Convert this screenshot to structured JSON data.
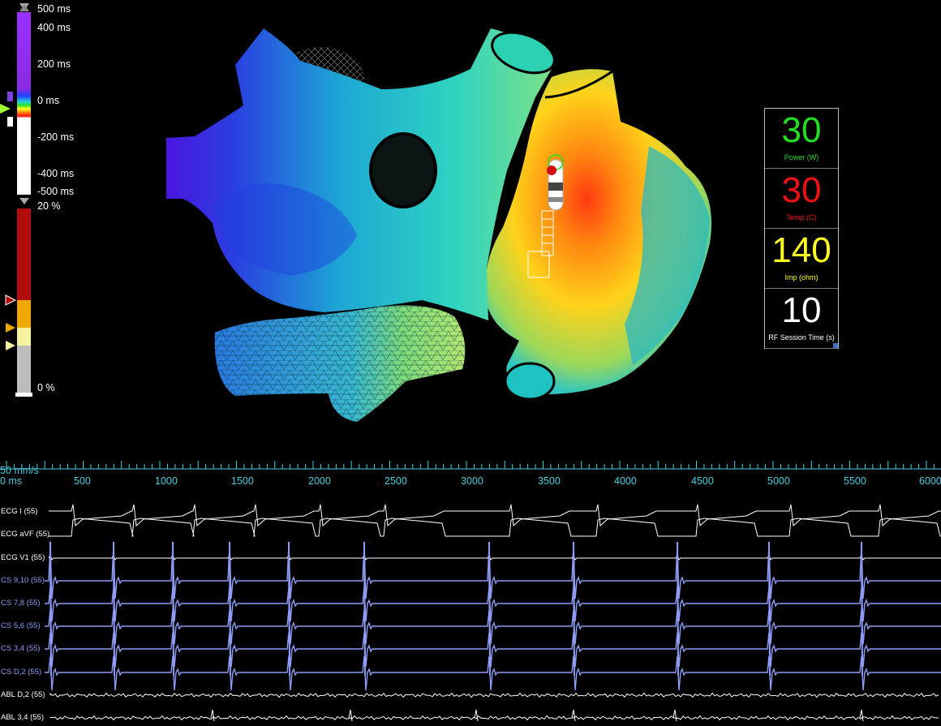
{
  "latency_scale": {
    "labels": [
      "500 ms",
      "400 ms",
      "200 ms",
      "0 ms",
      "-200 ms",
      "-400 ms",
      "-500 ms"
    ],
    "colors": {
      "late": "#8a2be2",
      "early": "#ffffff"
    }
  },
  "percent_scale": {
    "top_label": "20 %",
    "bottom_label": "0 %",
    "colors": {
      "dark_red": "#b00c0c",
      "orange": "#f0a800",
      "yellow": "#f6f3a0",
      "gray": "#bdbdbd"
    }
  },
  "rf_panel": {
    "power": {
      "value": "30",
      "label": "Power (W)",
      "color": "#22dd22"
    },
    "temp": {
      "value": "30",
      "label": "Temp (C)",
      "color": "#ee1111"
    },
    "imp": {
      "value": "140",
      "label": "Imp (ohm)",
      "color": "#ffff22"
    },
    "session": {
      "value": "10",
      "label": "RF Session Time (s)",
      "color": "#ffffff"
    }
  },
  "timeline": {
    "speed": "50 mm/s",
    "start_label": "0 ms",
    "ticks": [
      "500",
      "1000",
      "1500",
      "2000",
      "2500",
      "3000",
      "3500",
      "4000",
      "4500",
      "5000",
      "5500",
      "6000"
    ],
    "color": "#46cfe0"
  },
  "channels": [
    {
      "name": "ECG I (55)",
      "group": "ecg"
    },
    {
      "name": "ECG aVF (55)",
      "group": "ecg"
    },
    {
      "name": "ECG V1 (55)",
      "group": "ecg"
    },
    {
      "name": "CS 9,10 (55)",
      "group": "cs"
    },
    {
      "name": "CS 7,8 (55)",
      "group": "cs"
    },
    {
      "name": "CS 5,6 (55)",
      "group": "cs"
    },
    {
      "name": "CS 3,4 (55)",
      "group": "cs"
    },
    {
      "name": "CS D,2 (55)",
      "group": "cs"
    },
    {
      "name": "ABL D,2 (55)",
      "group": "ecg"
    },
    {
      "name": "ABL 3,4 (55)",
      "group": "ecg"
    }
  ]
}
